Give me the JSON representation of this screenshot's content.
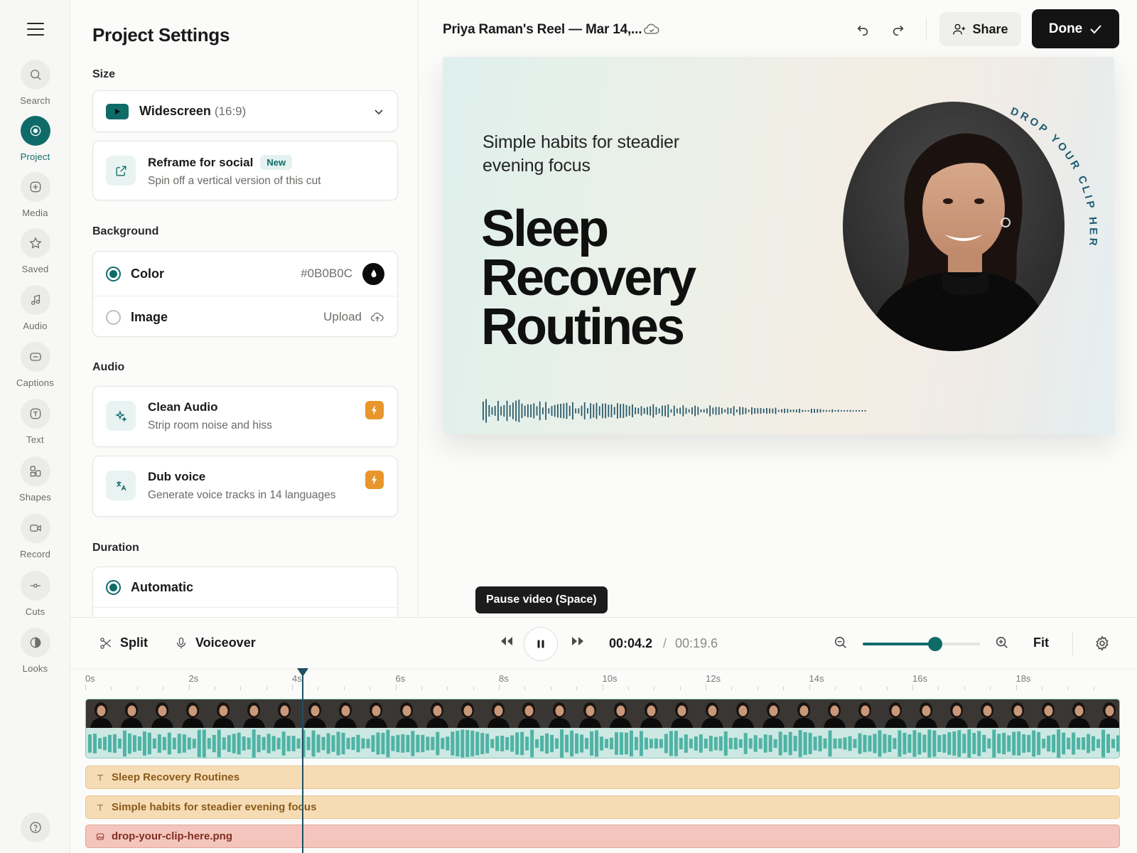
{
  "rail": {
    "items": [
      {
        "label": "Search",
        "icon": "search-icon"
      },
      {
        "label": "Project",
        "icon": "target-icon",
        "active": true
      },
      {
        "label": "Media",
        "icon": "plus-square-icon"
      },
      {
        "label": "Saved",
        "icon": "star-icon"
      },
      {
        "label": "Audio",
        "icon": "music-note-icon"
      },
      {
        "label": "Captions",
        "icon": "captions-icon"
      },
      {
        "label": "Text",
        "icon": "text-icon"
      },
      {
        "label": "Shapes",
        "icon": "shapes-icon"
      },
      {
        "label": "Record",
        "icon": "video-camera-icon"
      },
      {
        "label": "Cuts",
        "icon": "cut-icon"
      },
      {
        "label": "Looks",
        "icon": "contrast-icon"
      }
    ]
  },
  "panel": {
    "title": "Project Settings",
    "size": {
      "label": "Size",
      "selected_name": "Widescreen",
      "selected_ratio": "(16:9)"
    },
    "reframe": {
      "title": "Reframe for social",
      "badge": "New",
      "subtitle": "Spin off a vertical version of this cut"
    },
    "background": {
      "label": "Background",
      "color_label": "Color",
      "color_value": "#0B0B0C",
      "image_label": "Image",
      "image_action": "Upload",
      "selected": "color"
    },
    "audio": {
      "label": "Audio",
      "clean_title": "Clean Audio",
      "clean_sub": "Strip room noise and hiss",
      "dub_title": "Dub voice",
      "dub_sub": "Generate voice tracks in 14 languages"
    },
    "duration": {
      "label": "Duration",
      "automatic_label": "Automatic"
    }
  },
  "header": {
    "project_title": "Priya Raman's Reel — Mar 14,...",
    "share_label": "Share",
    "done_label": "Done"
  },
  "canvas": {
    "subtitle": "Simple habits for steadier evening focus",
    "title_lines": [
      "Sleep",
      "Recovery",
      "Routines"
    ],
    "badge_text": "DROP YOUR CLIP HERE"
  },
  "tooltip": "Pause video (Space)",
  "toolbar": {
    "split_label": "Split",
    "voiceover_label": "Voiceover",
    "time_current": "00:04.2",
    "time_separator": "/",
    "time_total": "00:19.6",
    "fit_label": "Fit",
    "zoom_level": 0.62
  },
  "timeline": {
    "ticks": [
      "0s",
      "2s",
      "4s",
      "6s",
      "8s",
      "10s",
      "12s",
      "14s",
      "16s",
      "18s"
    ],
    "playhead_seconds": 4.2,
    "total_seconds": 19.6,
    "tracks": {
      "text1": "Sleep Recovery Routines",
      "text2": "Simple habits for steadier evening focus",
      "image": "drop-your-clip-here.png"
    }
  }
}
